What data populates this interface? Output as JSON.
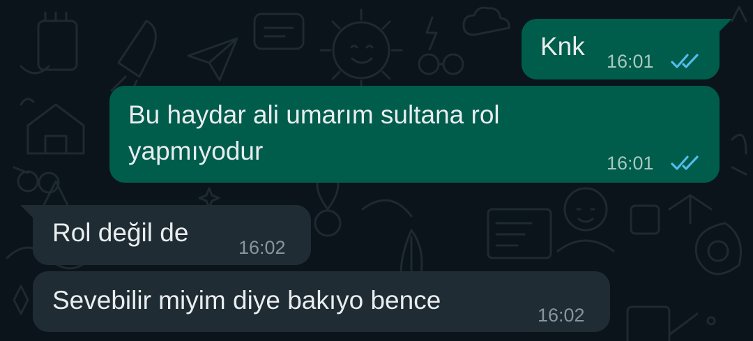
{
  "messages": [
    {
      "direction": "outgoing",
      "lines": [
        "Knk"
      ],
      "time": "16:01",
      "status": "read"
    },
    {
      "direction": "outgoing",
      "lines": [
        "Bu haydar ali umarım sultana rol",
        "yapmıyodur"
      ],
      "time": "16:01",
      "status": "read"
    },
    {
      "direction": "incoming",
      "lines": [
        "Rol değil de"
      ],
      "time": "16:02"
    },
    {
      "direction": "incoming",
      "lines": [
        "Sevebilir miyim diye bakıyo bence"
      ],
      "time": "16:02"
    }
  ],
  "colors": {
    "background": "#0b141a",
    "outgoing_bubble": "#005c4b",
    "incoming_bubble": "#202c33",
    "read_ticks": "#53bdeb",
    "timestamp": "#8696a0"
  },
  "icons": {
    "read_receipt": "double-check-icon",
    "wallpaper": "doodle-pattern"
  }
}
